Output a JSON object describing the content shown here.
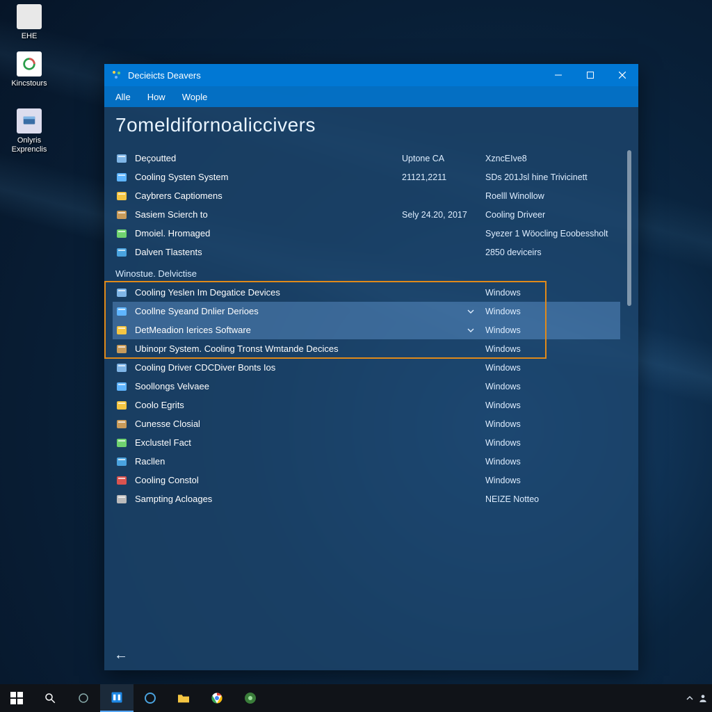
{
  "desktop": {
    "icons": [
      {
        "label": "EHE"
      },
      {
        "label": "Kincstours"
      },
      {
        "label": "Onlyris Exprenclis"
      }
    ]
  },
  "window": {
    "title": "Decieicts Deavers",
    "menu": [
      "Alle",
      "How",
      "Wople"
    ],
    "pageTitle": "7omeldifornoaliccivers",
    "topRows": [
      {
        "label": "Deçoutted",
        "mid": "Uptone CA",
        "right": "XzncEIve8"
      },
      {
        "label": "Cooling Systen System",
        "mid": "21121,2211",
        "right": "SDs 201Jsl hine Trivicinett"
      },
      {
        "label": "Caybrers Captiomens",
        "mid": "",
        "right": "Roelll Winollow"
      },
      {
        "label": "Sasiem Scierch to",
        "mid": "Sely 24.20, 2017",
        "right": "Cooling Driveer"
      },
      {
        "label": "Dmoiel. Hromaged",
        "mid": "",
        "right": "Syezer 1 Wöocling Eoobessholt"
      },
      {
        "label": "Dalven Tlastents",
        "mid": "",
        "right": "2850 deviceirs"
      }
    ],
    "sectionA": "Winostue. Delvictise",
    "highlightRows": [
      {
        "label": "Cooling Yeslen Im Degatice Devices",
        "right": "Windows",
        "chev": false,
        "sel": false
      },
      {
        "label": "Coollne Syeand Dnlier Derioes",
        "right": "Windows",
        "chev": true,
        "sel": true
      },
      {
        "label": "DetMeadion Ierices Software",
        "right": "Windows",
        "chev": true,
        "sel": true
      },
      {
        "label": "Ubinopr System. Cooling Tronst Wmtande Decices",
        "right": "Windows",
        "chev": false,
        "sel": false
      }
    ],
    "bottomRows": [
      {
        "label": "Cooling Driver CDCDiver Bonts Ios",
        "right": "Windows"
      },
      {
        "label": "Soollongs Velvaee",
        "right": "Windows"
      },
      {
        "label": "Coolo Egrits",
        "right": "Windows"
      },
      {
        "label": "Cunesse Closial",
        "right": "Windows"
      },
      {
        "label": "Exclustel Fact",
        "right": "Windows"
      },
      {
        "label": "Racllen",
        "right": "Windows"
      },
      {
        "label": "Cooling Constol",
        "right": "Windows"
      },
      {
        "label": "Sampting Acloages",
        "right": "NEIZE Notteo"
      }
    ]
  },
  "colors": {
    "accent": "#0178d4",
    "highlight": "#e08a1a"
  }
}
